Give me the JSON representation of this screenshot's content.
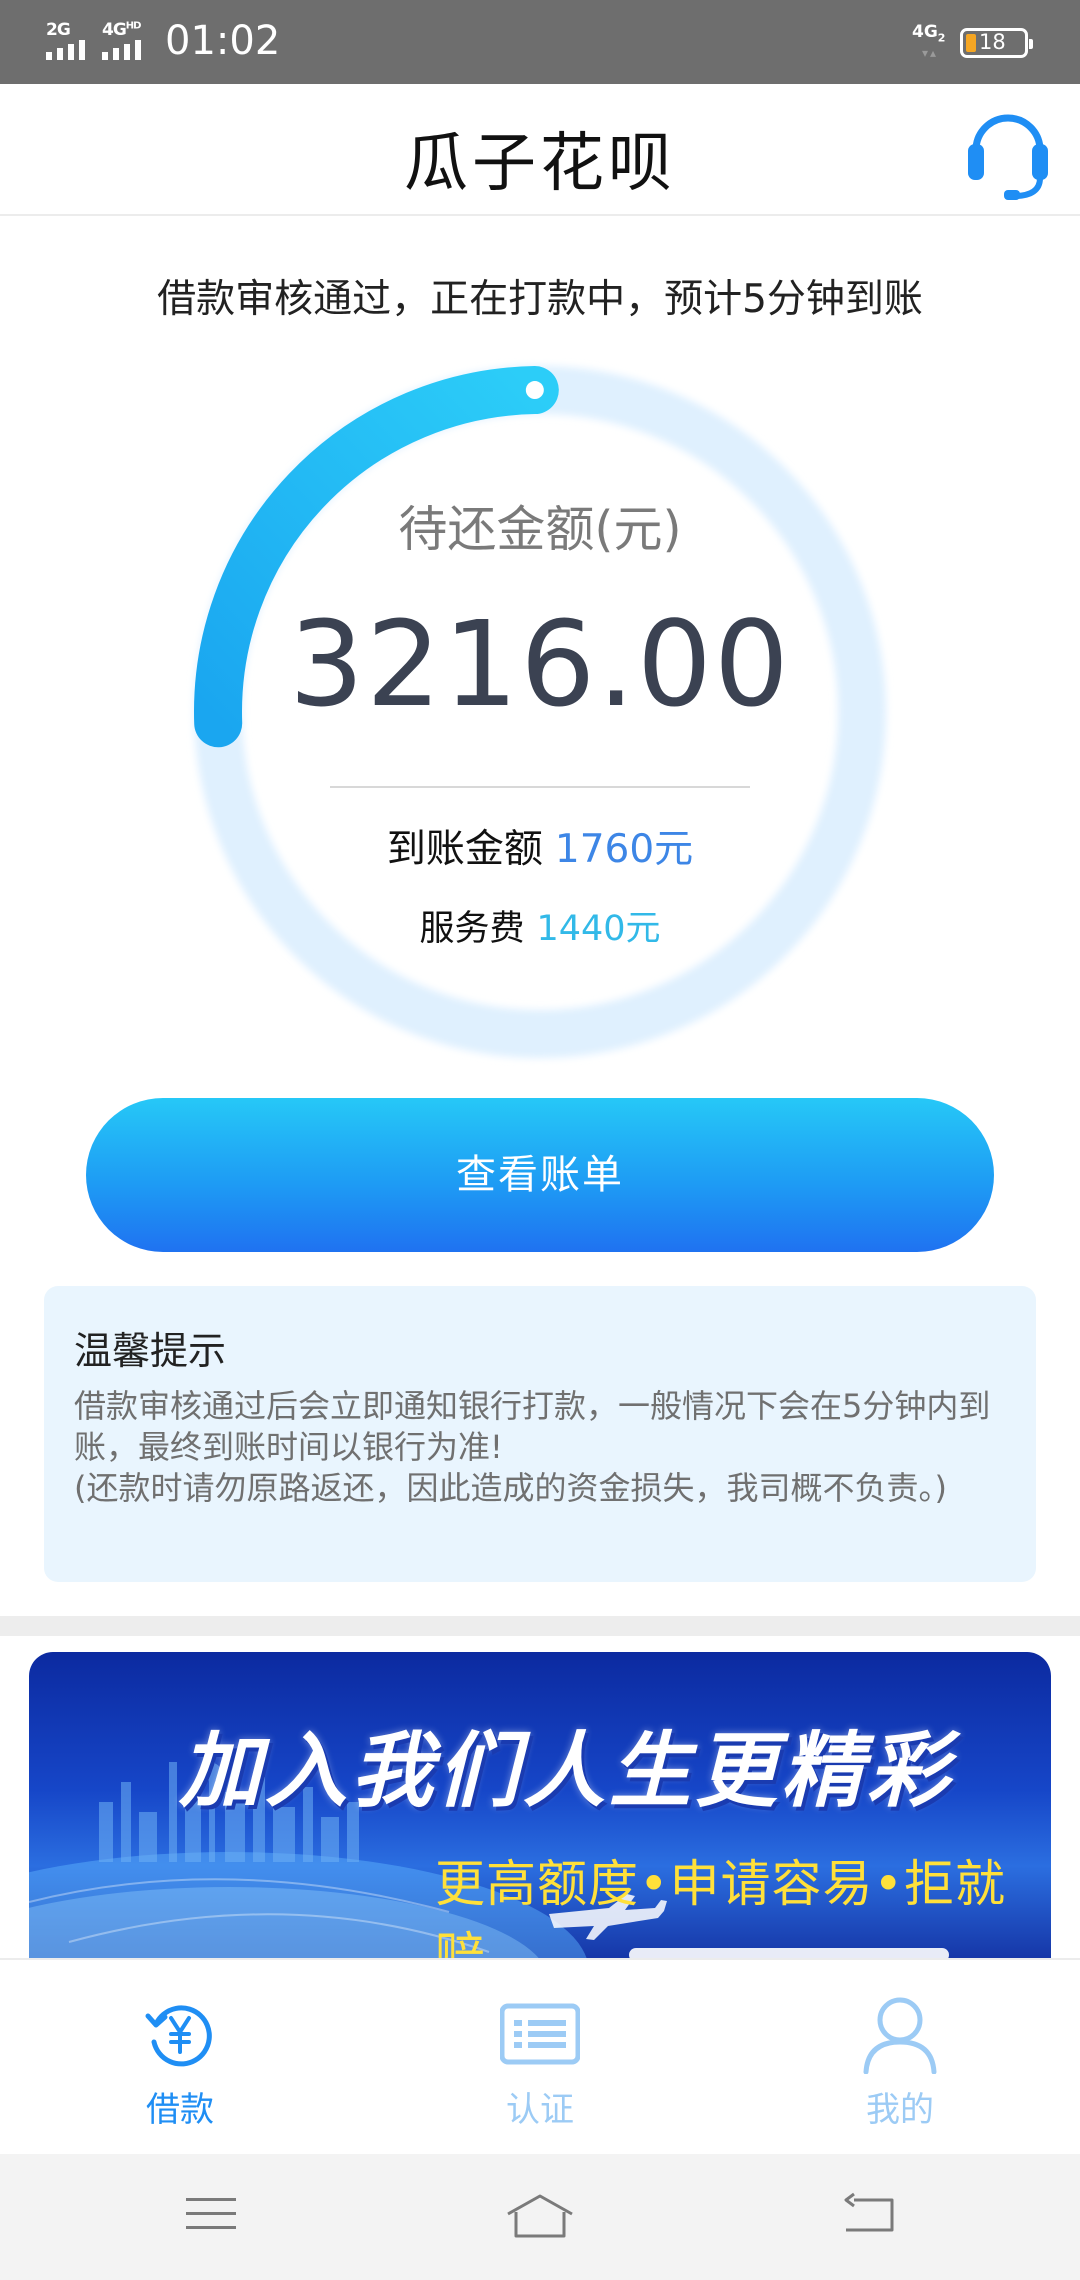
{
  "status_bar": {
    "sim1": "2G",
    "sim2": "4G",
    "sim2_sup": "HD",
    "time": "01:02",
    "network": "4G",
    "network_sub": "2",
    "battery": "18"
  },
  "header": {
    "title": "瓜子花呗",
    "service_icon": "customer-service-headset-icon"
  },
  "main": {
    "notice": "借款审核通过，正在打款中，预计5分钟到账",
    "amount_label": "待还金额(元)",
    "amount_value": "3216.00",
    "arrive_label": "到账金额",
    "arrive_value": "1760元",
    "fee_label": "服务费",
    "fee_value": "1440元",
    "button_label": "查看账单"
  },
  "tips": {
    "title": "温馨提示",
    "line1": "借款审核通过后会立即通知银行打款，一般情况下会在5分钟内到账，最终到账时间以银行为准!",
    "line2": "(还款时请勿原路返还，因此造成的资金损失，我司概不负责。)"
  },
  "banner": {
    "title": "加入我们人生更精彩",
    "subtitle": "更高额度•申请容易•拒就赔"
  },
  "tabs": [
    {
      "label": "借款",
      "icon": "loan-yen-icon",
      "active": true
    },
    {
      "label": "认证",
      "icon": "id-card-icon",
      "active": false
    },
    {
      "label": "我的",
      "icon": "user-icon",
      "active": false
    }
  ],
  "colors": {
    "accent": "#1f8ef4",
    "accent_light": "#26c8f7",
    "tab_inactive": "#9ccbf5",
    "tips_bg": "#e9f5fe",
    "arrive_value": "#3d86e6",
    "fee_value": "#32b9e8"
  },
  "ring_progress": 0.23
}
